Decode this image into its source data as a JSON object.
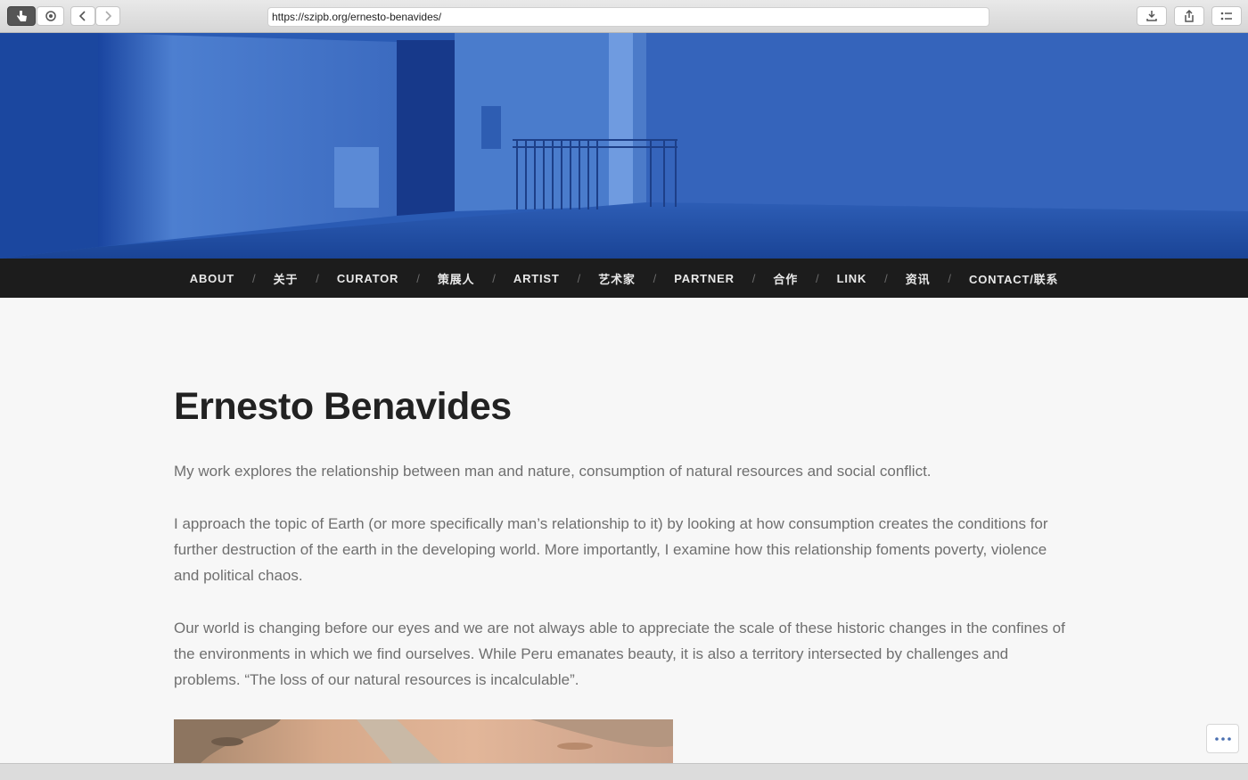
{
  "browser": {
    "url": "https://szipb.org/ernesto-benavides/"
  },
  "nav": {
    "items": [
      {
        "label": "ABOUT"
      },
      {
        "label": "关于"
      },
      {
        "label": "CURATOR"
      },
      {
        "label": "策展人"
      },
      {
        "label": "ARTIST"
      },
      {
        "label": "艺术家"
      },
      {
        "label": "PARTNER"
      },
      {
        "label": "合作"
      },
      {
        "label": "LINK"
      },
      {
        "label": "资讯"
      },
      {
        "label": "CONTACT/联系"
      }
    ],
    "separator": "/"
  },
  "article": {
    "title": "Ernesto Benavides",
    "paragraphs": [
      "My work explores the relationship between man and nature, consumption of natural resources and social conflict.",
      "I approach the topic of Earth (or more specifically man’s relationship to it) by looking at how consumption creates the conditions for further destruction of the earth in the developing world. More importantly, I examine how this relationship foments poverty, violence and political chaos.",
      "Our world is changing before our eyes and we are not always able to appreciate the scale of these historic changes in the confines of the environments in which we find ourselves. While Peru emanates beauty, it is also a territory intersected by challenges and problems. “The loss of our natural resources is incalculable”."
    ]
  },
  "colors": {
    "hero_blue": "#1f4fa5",
    "nav_bg": "#1c1c1c",
    "text_gray": "#6f6f6f"
  }
}
